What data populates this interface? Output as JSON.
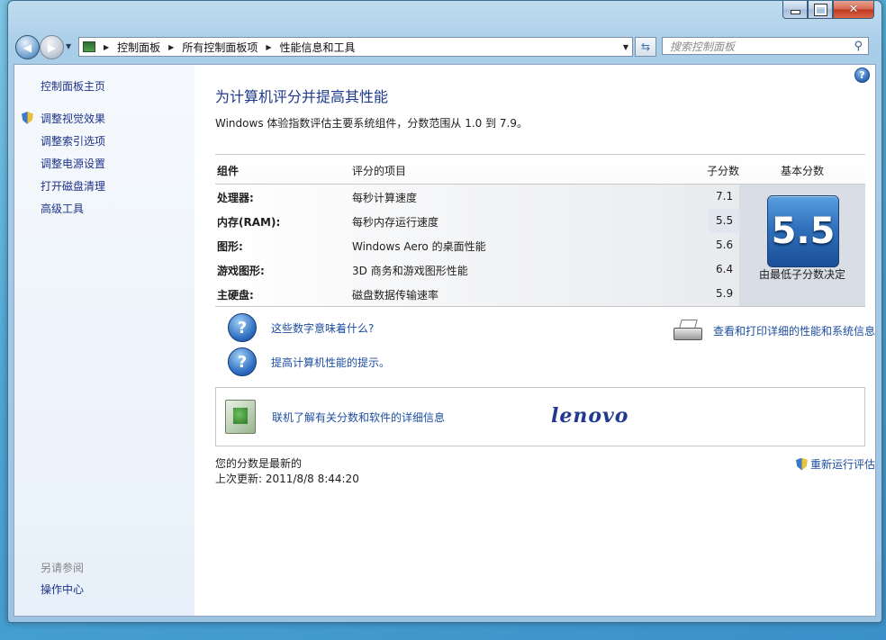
{
  "window": {
    "caption_buttons": {
      "minimize": "–",
      "maximize": "□",
      "close": "✕"
    }
  },
  "nav": {
    "breadcrumbs": [
      "控制面板",
      "所有控制面板项",
      "性能信息和工具"
    ],
    "search_placeholder": "搜索控制面板"
  },
  "sidebar": {
    "home": "控制面板主页",
    "items": [
      {
        "label": "调整视觉效果",
        "icon": "shield-icon"
      },
      {
        "label": "调整索引选项"
      },
      {
        "label": "调整电源设置"
      },
      {
        "label": "打开磁盘清理"
      },
      {
        "label": "高级工具"
      }
    ],
    "see_also_label": "另请参阅",
    "see_also_items": [
      "操作中心"
    ]
  },
  "main": {
    "title": "为计算机评分并提高其性能",
    "description": "Windows 体验指数评估主要系统组件，分数范围从 1.0 到 7.9。",
    "table": {
      "headers": {
        "component": "组件",
        "rated": "评分的项目",
        "subscore": "子分数",
        "basescore": "基本分数"
      },
      "rows": [
        {
          "component": "处理器:",
          "rated": "每秒计算速度",
          "subscore": "7.1"
        },
        {
          "component": "内存(RAM):",
          "rated": "每秒内存运行速度",
          "subscore": "5.5"
        },
        {
          "component": "图形:",
          "rated": "Windows Aero 的桌面性能",
          "subscore": "5.6"
        },
        {
          "component": "游戏图形:",
          "rated": "3D 商务和游戏图形性能",
          "subscore": "6.4"
        },
        {
          "component": "主硬盘:",
          "rated": "磁盘数据传输速率",
          "subscore": "5.9"
        }
      ],
      "base_score": "5.5",
      "base_caption": "由最低子分数决定"
    },
    "links": {
      "meaning": "这些数字意味着什么?",
      "tips": "提高计算机性能的提示。",
      "print": "查看和打印详细的性能和系统信息"
    },
    "online_info": "联机了解有关分数和软件的详细信息",
    "oem_logo": "lenovo",
    "status_line": "您的分数是最新的",
    "last_update": "上次更新: 2011/8/8 8:44:20",
    "rerun": "重新运行评估"
  },
  "colors": {
    "link": "#1e4ea0",
    "title": "#1e3a8a",
    "badge": "#2f71bd",
    "sidebar_bg": "#e7f0fa"
  }
}
